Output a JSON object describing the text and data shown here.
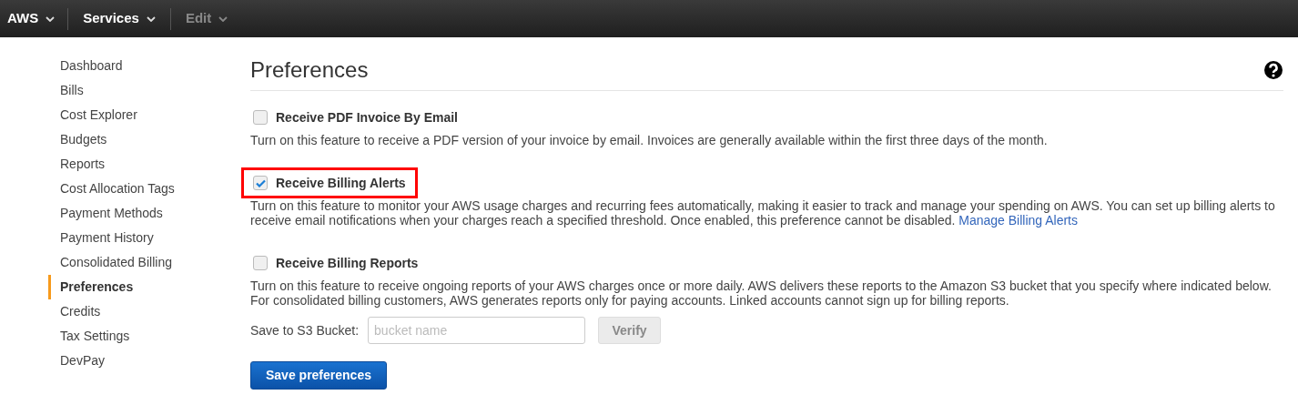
{
  "topbar": {
    "menus": [
      {
        "label": "AWS",
        "disabled": false
      },
      {
        "label": "Services",
        "disabled": false
      },
      {
        "label": "Edit",
        "disabled": true
      }
    ]
  },
  "sidebar": {
    "items": [
      {
        "label": "Dashboard",
        "selected": false
      },
      {
        "label": "Bills",
        "selected": false
      },
      {
        "label": "Cost Explorer",
        "selected": false
      },
      {
        "label": "Budgets",
        "selected": false
      },
      {
        "label": "Reports",
        "selected": false
      },
      {
        "label": "Cost Allocation Tags",
        "selected": false
      },
      {
        "label": "Payment Methods",
        "selected": false
      },
      {
        "label": "Payment History",
        "selected": false
      },
      {
        "label": "Consolidated Billing",
        "selected": false
      },
      {
        "label": "Preferences",
        "selected": true
      },
      {
        "label": "Credits",
        "selected": false
      },
      {
        "label": "Tax Settings",
        "selected": false
      },
      {
        "label": "DevPay",
        "selected": false
      }
    ]
  },
  "page": {
    "title": "Preferences",
    "options": [
      {
        "label": "Receive PDF Invoice By Email",
        "checked": false,
        "highlighted": false,
        "description": "Turn on this feature to receive a PDF version of your invoice by email. Invoices are generally available within the first three days of the month."
      },
      {
        "label": "Receive Billing Alerts",
        "checked": true,
        "highlighted": true,
        "description": "Turn on this feature to monitor your AWS usage charges and recurring fees automatically, making it easier to track and manage your spending on AWS. You can set up billing alerts to receive email notifications when your charges reach a specified threshold. Once enabled, this preference cannot be disabled.",
        "link": "Manage Billing Alerts"
      },
      {
        "label": "Receive Billing Reports",
        "checked": false,
        "highlighted": false,
        "description": "Turn on this feature to receive ongoing reports of your AWS charges once or more daily. AWS delivers these reports to the Amazon S3 bucket that you specify where indicated below. For consolidated billing customers, AWS generates reports only for paying accounts. Linked accounts cannot sign up for billing reports.",
        "bucket": {
          "label": "Save to S3 Bucket:",
          "placeholder": "bucket name",
          "button": "Verify"
        }
      }
    ],
    "save_button": "Save preferences"
  }
}
